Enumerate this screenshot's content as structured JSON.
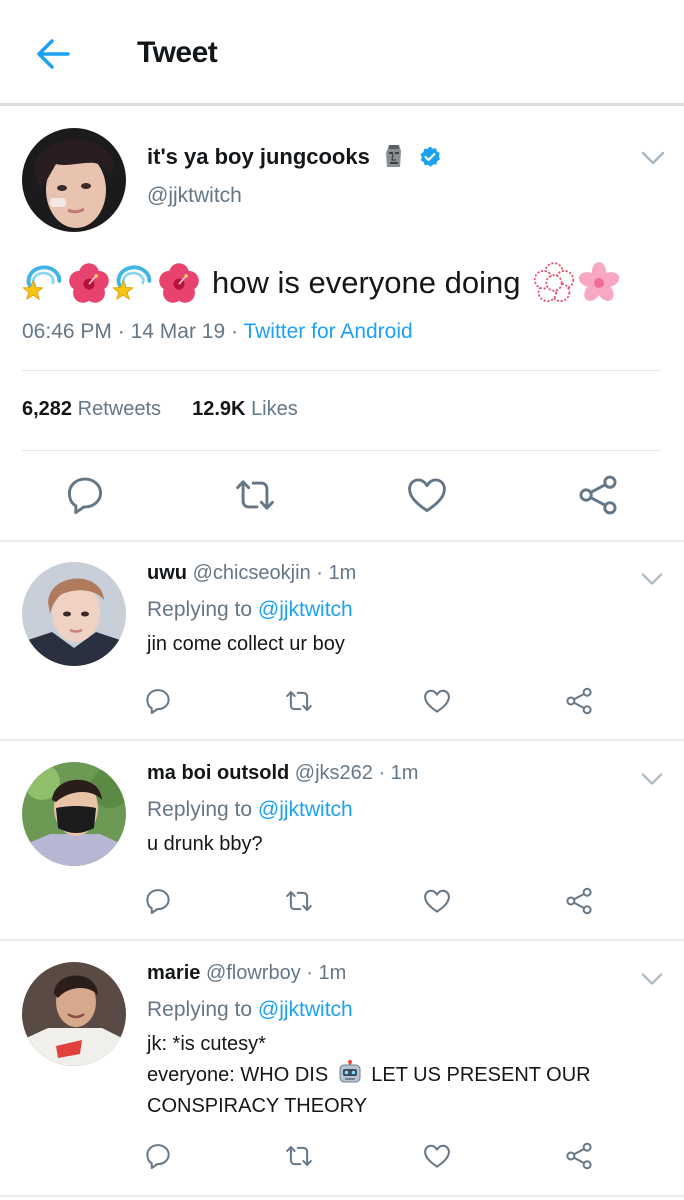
{
  "header": {
    "title": "Tweet"
  },
  "tweet": {
    "author_name": "it's ya boy jungcooks",
    "author_handle": "@jjktwitch",
    "text": "how is everyone doing",
    "time": "06:46 PM",
    "sep1": "·",
    "date": "14 Mar 19",
    "sep2": "·",
    "source": "Twitter for Android",
    "retweets_count": "6,282",
    "retweets_label": "Retweets",
    "likes_count": "12.9K",
    "likes_label": "Likes"
  },
  "replies": [
    {
      "name": "uwu",
      "handle": "@chicseokjin",
      "time": "· 1m",
      "replying_prefix": "Replying to",
      "replying_to": "@jjktwitch",
      "text_lines": [
        "jin come collect ur boy"
      ]
    },
    {
      "name": "ma boi outsold",
      "handle": "@jks262",
      "time": "· 1m",
      "replying_prefix": "Replying to",
      "replying_to": "@jjktwitch",
      "text_lines": [
        "u drunk bby?"
      ]
    },
    {
      "name": "marie",
      "handle": "@flowrboy",
      "time": "· 1m",
      "replying_prefix": "Replying to",
      "replying_to": "@jjktwitch",
      "text_lines": [
        "jk: *is cutesy*",
        "everyone: WHO DIS",
        "LET US PRESENT OUR",
        "CONSPIRACY THEORY"
      ]
    }
  ],
  "colors": {
    "accent": "#1da1f2",
    "secondary_text": "#657786",
    "divider": "#e1e8ed"
  },
  "icons": [
    "back-arrow-icon",
    "moai-emoji-icon",
    "verified-badge-icon",
    "chevron-down-icon",
    "dizzy-emoji-icon",
    "hibiscus-emoji-icon",
    "white-flower-emoji-icon",
    "cherry-blossom-emoji-icon",
    "reply-icon",
    "retweet-icon",
    "like-icon",
    "share-icon",
    "robot-emoji-icon"
  ]
}
